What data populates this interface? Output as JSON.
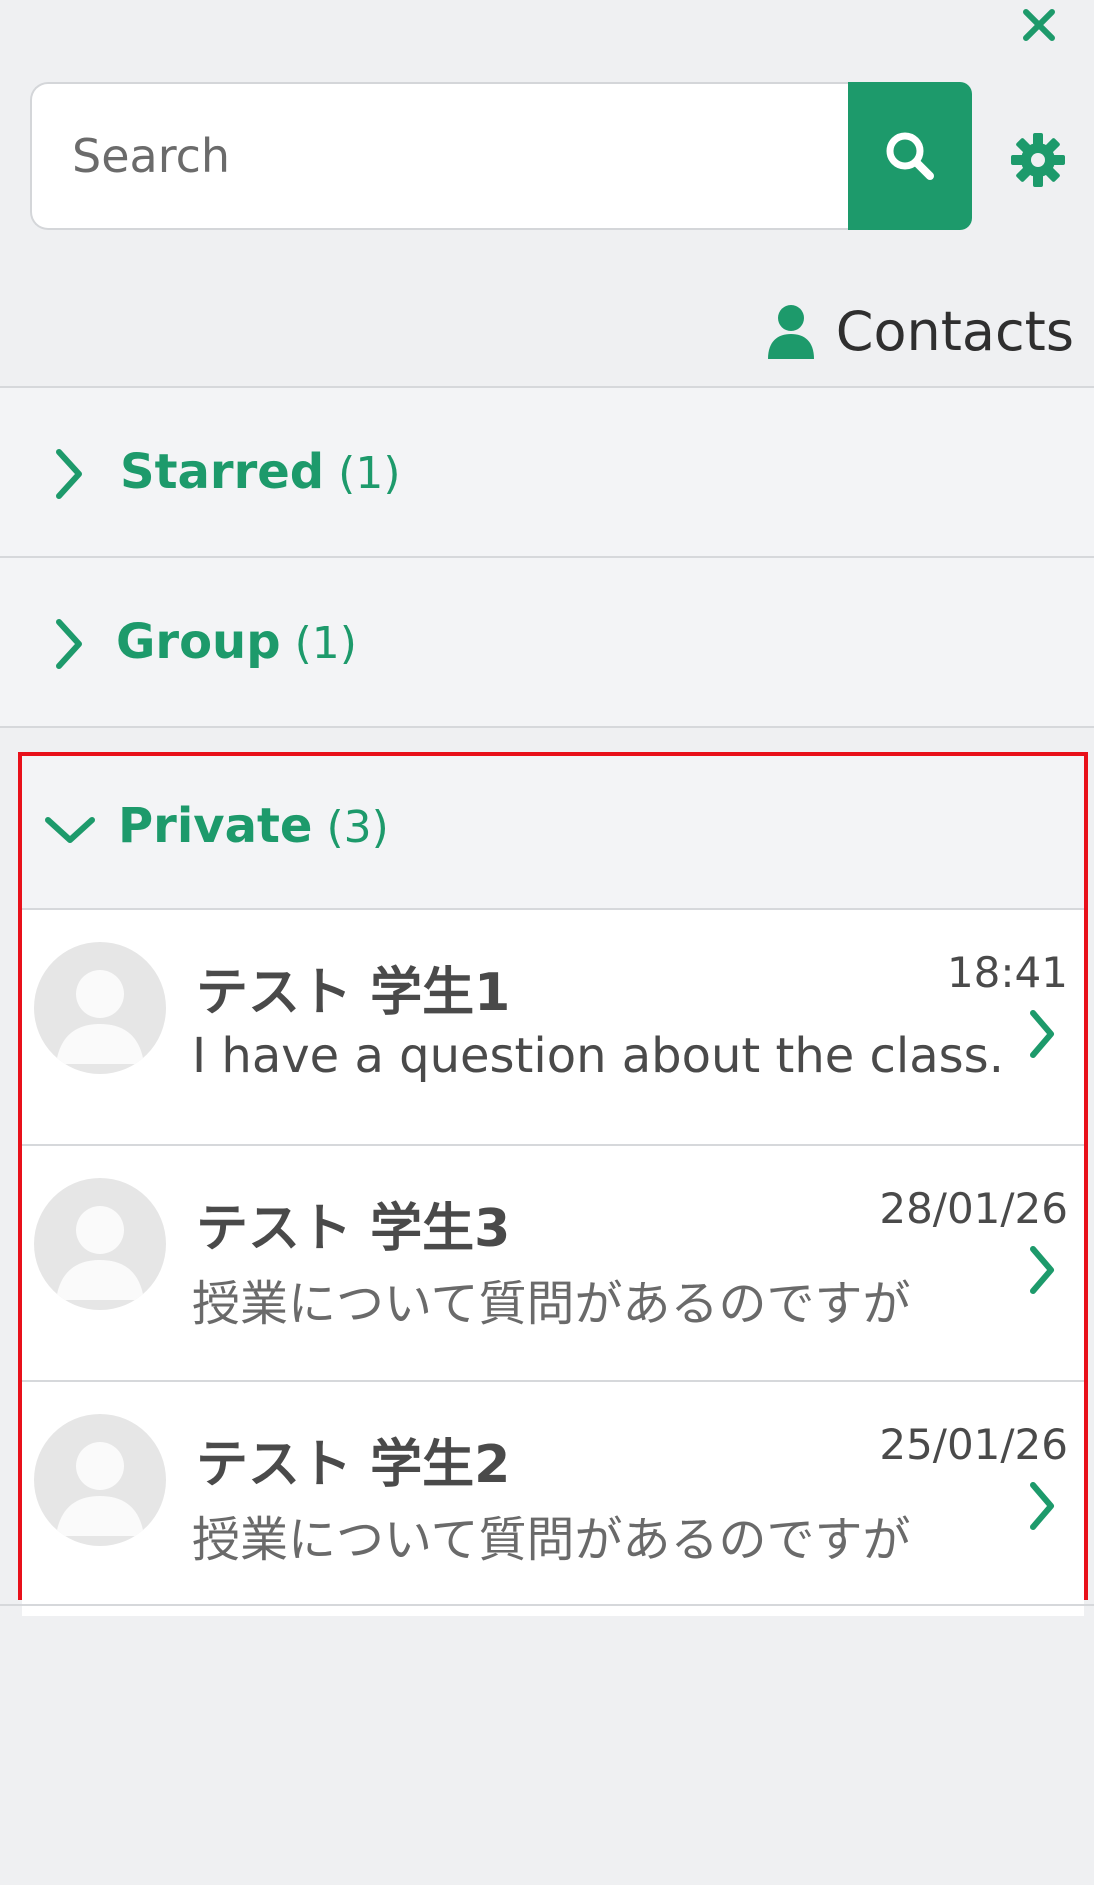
{
  "header": {
    "close_icon": "close-icon",
    "settings_icon": "gear-icon"
  },
  "search": {
    "placeholder": "Search",
    "value": "",
    "button_icon": "search-icon"
  },
  "contacts": {
    "label": "Contacts",
    "icon": "user-icon"
  },
  "sections": {
    "starred": {
      "label": "Starred",
      "count": "(1)",
      "expanded": false
    },
    "group": {
      "label": "Group",
      "count": "(1)",
      "expanded": false
    },
    "private": {
      "label": "Private",
      "count": "(3)",
      "expanded": true
    }
  },
  "conversations": [
    {
      "name": "テスト 学生1",
      "time": "18:41",
      "preview": "I have a question about the class."
    },
    {
      "name": "テスト 学生3",
      "time": "28/01/26",
      "preview": "授業について質問があるのですが"
    },
    {
      "name": "テスト 学生2",
      "time": "25/01/26",
      "preview": "授業について質問があるのですが"
    }
  ],
  "colors": {
    "accent": "#1d9a6b",
    "highlight_border": "#e8101a",
    "background": "#eff0f2"
  }
}
